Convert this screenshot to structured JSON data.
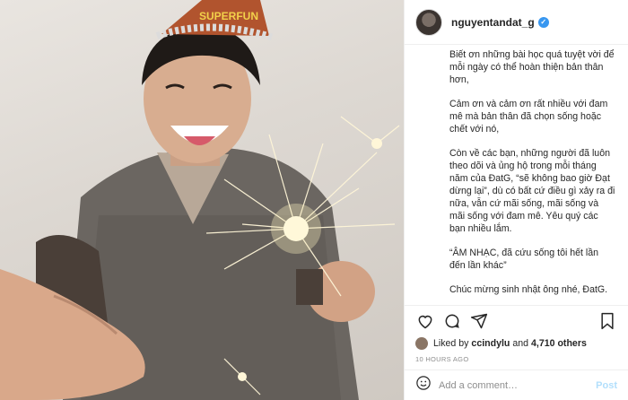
{
  "header": {
    "username": "nguyentandat_g"
  },
  "caption": {
    "paragraphs": [
      "Biết ơn những bài học quá tuyệt vời để mỗi ngày có thể hoàn thiện bản thân hơn,",
      "Cảm ơn và cảm ơn rất nhiều với đam mê mà bản thân đã chọn sống hoặc chết với nó,",
      "Còn về các bạn, những người đã luôn theo dõi và ủng hộ trong mỗi tháng năm của ĐatG, “sẽ không bao giờ Đạt dừng lại”, dù có bất cứ điều gì xảy ra đi nữa, vẫn cứ mãi sống, mãi sống và mãi sống với đam mê. Yêu quý các bạn nhiều lắm.",
      "“ÂM NHẠC, đã cứu sống tôi hết lần đến lần khác”",
      "Chúc mừng sinh nhật ông nhé, ĐatG."
    ]
  },
  "likes": {
    "prefix": "Liked by ",
    "user": "ccindylu",
    "joiner": " and ",
    "count": "4,710 others"
  },
  "timestamp": "10 HOURS AGO",
  "comment": {
    "placeholder": "Add a comment…",
    "post_label": "Post"
  },
  "photo": {
    "hat_text": "SUPERFUN"
  },
  "colors": {
    "link_blue": "#b2dffc",
    "verified_blue": "#3897f0",
    "muted_text": "#8e8e8e"
  },
  "icons": [
    "heart-icon",
    "comment-icon",
    "share-icon",
    "save-icon",
    "emoji-icon",
    "verified-badge-icon"
  ]
}
